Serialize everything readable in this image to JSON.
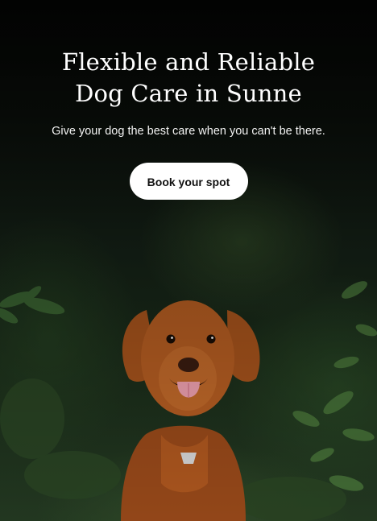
{
  "hero": {
    "title_line1": "Flexible and Reliable",
    "title_line2": "Dog Care in Sunne",
    "subtitle": "Give your dog the best care when you can't be there.",
    "cta_label": "Book your spot",
    "image": "dog-in-forest-photo"
  }
}
